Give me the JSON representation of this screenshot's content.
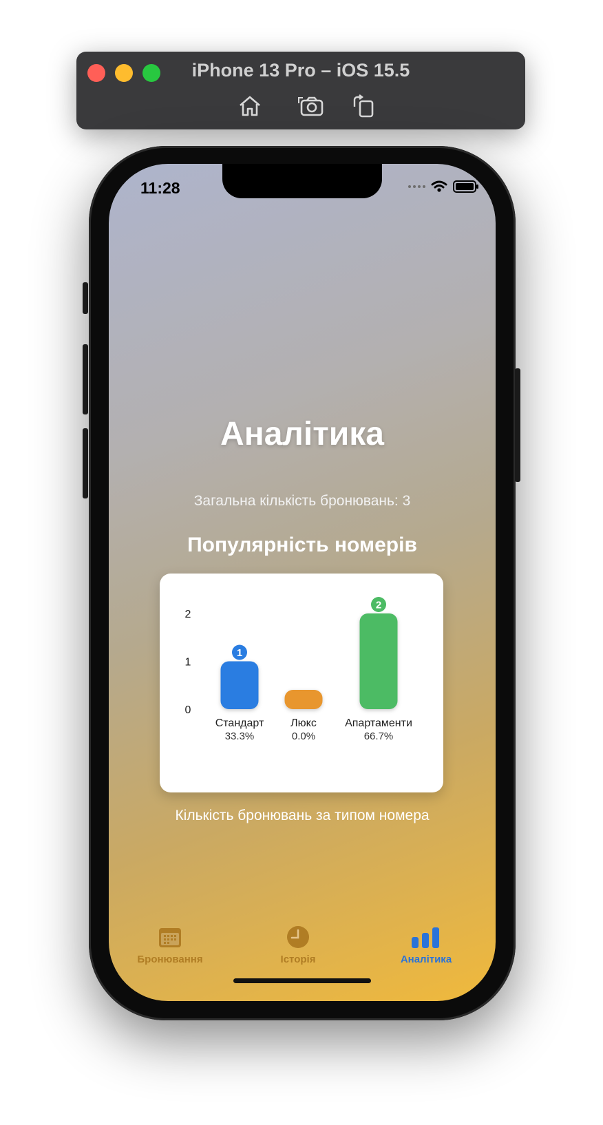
{
  "simulator": {
    "title": "iPhone 13 Pro – iOS 15.5",
    "buttons": [
      "home-icon",
      "screenshot-icon",
      "rotate-icon"
    ]
  },
  "status_bar": {
    "time": "11:28"
  },
  "screen": {
    "title": "Аналітика",
    "total_bookings": "Загальна кількість бронювань: 3",
    "section_title": "Популярність номерів",
    "chart_caption": "Кількість бронювань за типом номера"
  },
  "chart_data": {
    "type": "bar",
    "categories": [
      "Стандарт",
      "Люкс",
      "Апартаменти"
    ],
    "values": [
      1,
      0,
      2
    ],
    "percent_labels": [
      "33.3%",
      "0.0%",
      "66.7%"
    ],
    "value_badges": [
      "1",
      "",
      "2"
    ],
    "colors": [
      "#2a7de1",
      "#e8962e",
      "#4cbb64"
    ],
    "y_ticks": [
      "2",
      "1",
      "0"
    ],
    "ylim": [
      0,
      2
    ],
    "grid": false
  },
  "tabbar": {
    "items": [
      {
        "label": "Бронювання",
        "icon": "calendar-icon",
        "color": "#b07d24"
      },
      {
        "label": "Історія",
        "icon": "clock-icon",
        "color": "#b07d24"
      },
      {
        "label": "Аналітика",
        "icon": "chart-bar-icon",
        "color": "#2a73d8",
        "selected": true
      }
    ]
  }
}
